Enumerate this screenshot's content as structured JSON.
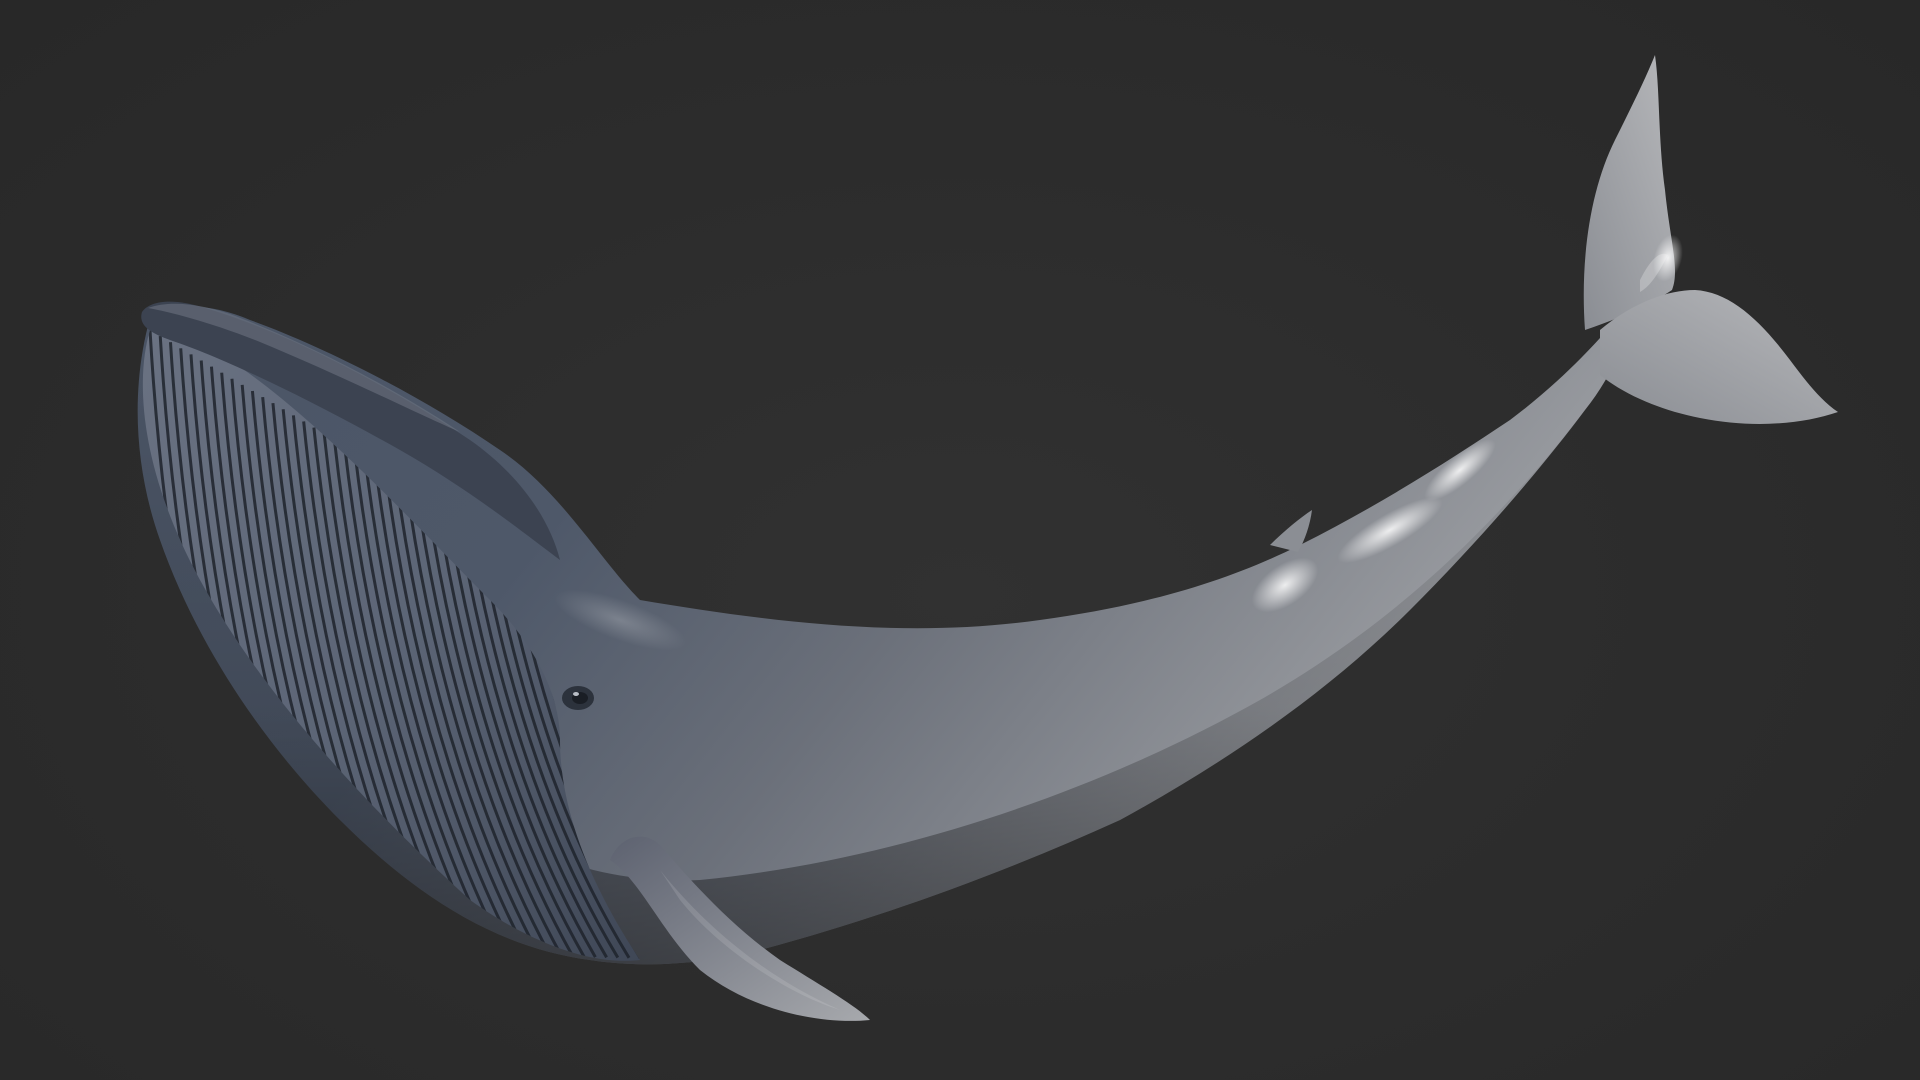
{
  "scene": {
    "subject_icon": "whale-icon",
    "colors": {
      "background": "#2b2b2b",
      "whale_dark": "#3a4250",
      "whale_mid": "#5a6272",
      "whale_light": "#9a9da3",
      "throat_grooves": "#1e232b",
      "highlight": "#e9ecef"
    }
  }
}
